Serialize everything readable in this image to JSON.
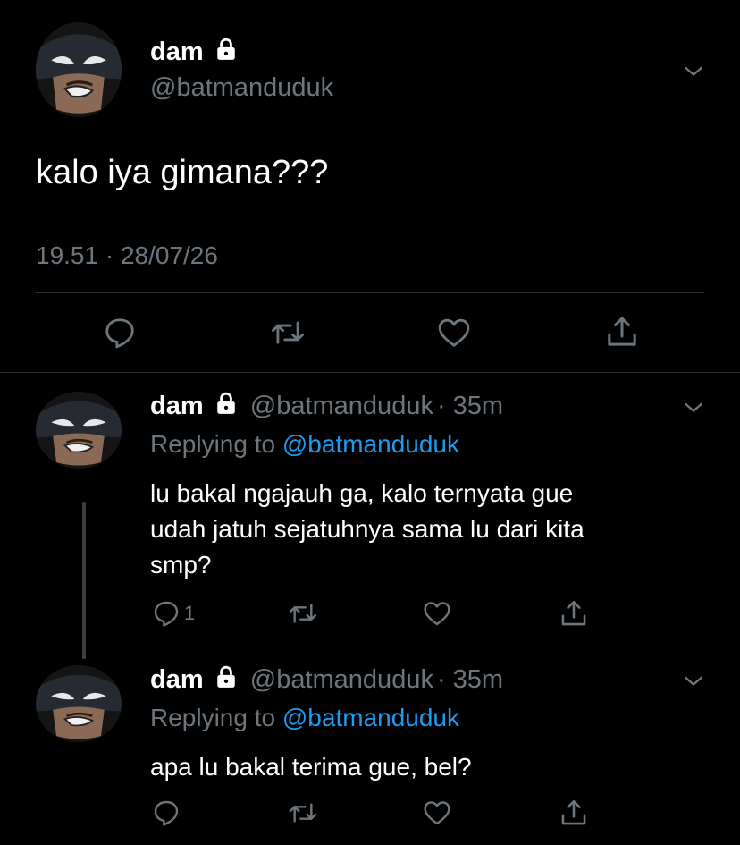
{
  "main_tweet": {
    "display_name": "dam",
    "handle": "@batmanduduk",
    "text": "kalo iya gimana???",
    "timestamp": "19.51 · 28/07/26"
  },
  "replies": [
    {
      "display_name": "dam",
      "handle": "@batmanduduk",
      "time": "· 35m",
      "replying_label": "Replying to",
      "replying_to": "@batmanduduk",
      "text_lines": [
        "lu bakal ngajauh ga, kalo ternyata gue",
        "udah jatuh sejatuhnya sama lu dari kita",
        "smp?"
      ],
      "reply_count": "1"
    },
    {
      "display_name": "dam",
      "handle": "@batmanduduk",
      "time": "· 35m",
      "replying_label": "Replying to",
      "replying_to": "@batmanduduk",
      "text_lines": [
        "apa lu bakal terima gue, bel?"
      ],
      "reply_count": ""
    }
  ],
  "icons": {
    "reply": "reply-icon",
    "retweet": "retweet-icon",
    "like": "like-icon",
    "share": "share-icon",
    "lock": "lock-icon",
    "more": "chevron-down-icon"
  },
  "colors": {
    "background": "#000000",
    "text": "#ffffff",
    "muted": "#6e767d",
    "link": "#1d9bf0",
    "divider": "#2f3336"
  }
}
